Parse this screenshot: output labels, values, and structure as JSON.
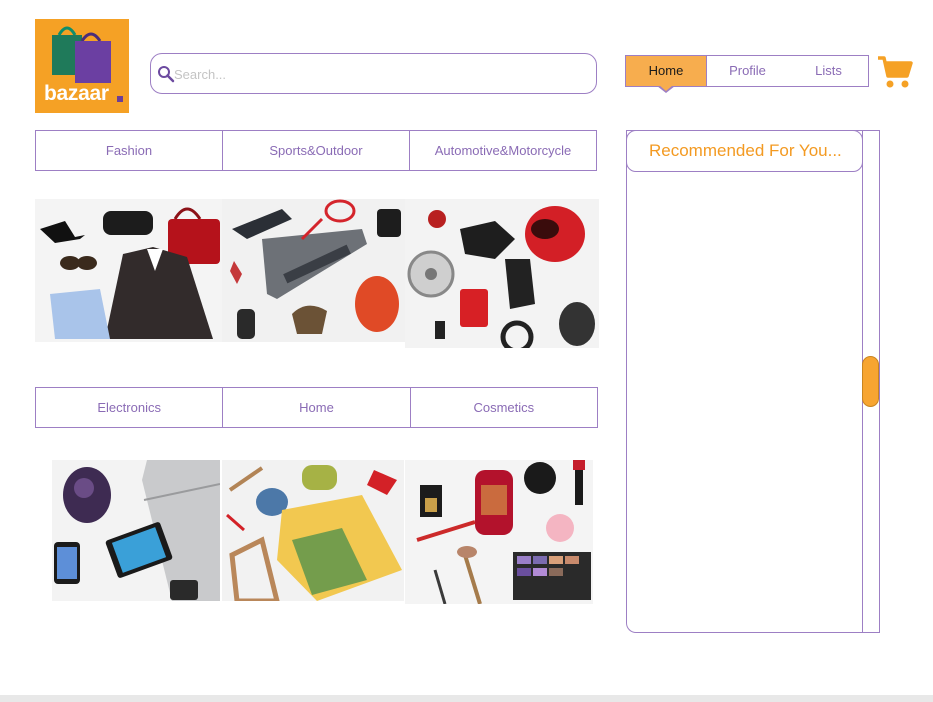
{
  "brand": {
    "name": "bazaar",
    "colors": {
      "accent": "#f5a125",
      "purple": "#8a6bb5",
      "border": "#9d7fc4"
    }
  },
  "search": {
    "placeholder": "Search...",
    "value": "",
    "icon": "search-icon"
  },
  "nav": {
    "tabs": [
      {
        "label": "Home",
        "active": true
      },
      {
        "label": "Profile",
        "active": false
      },
      {
        "label": "Lists",
        "active": false
      }
    ]
  },
  "cart": {
    "icon": "cart-icon"
  },
  "categories_top": [
    {
      "label": "Fashion"
    },
    {
      "label": "Sports&Outdoor"
    },
    {
      "label": "Automotive&Motorcycle"
    }
  ],
  "categories_bottom": [
    {
      "label": "Electronics"
    },
    {
      "label": "Home"
    },
    {
      "label": "Cosmetics"
    }
  ],
  "tiles": [
    {
      "name": "fashion-image"
    },
    {
      "name": "sports-outdoor-image"
    },
    {
      "name": "automotive-image"
    },
    {
      "name": "electronics-image"
    },
    {
      "name": "home-image"
    },
    {
      "name": "cosmetics-image"
    }
  ],
  "recommended": {
    "title": "Recommended For You..."
  }
}
